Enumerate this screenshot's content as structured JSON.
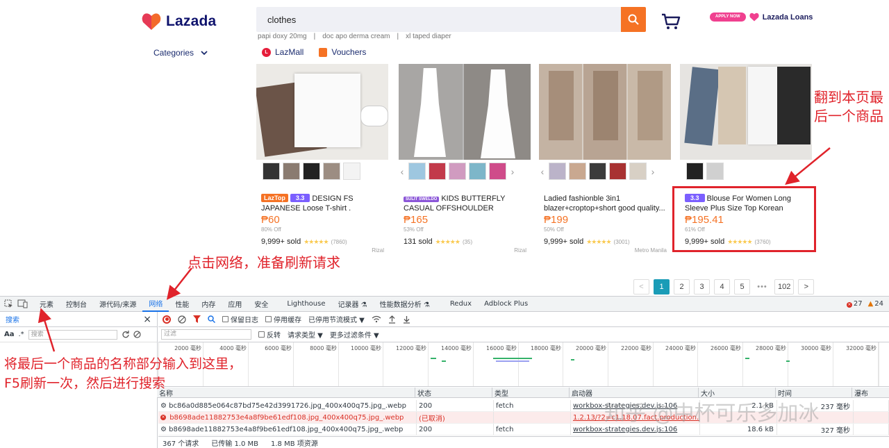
{
  "header": {
    "logo_text": "Lazada",
    "search_value": "clothes",
    "suggestions": [
      "papi doxy 20mg",
      "doc apo derma cream",
      "xl taped diaper"
    ],
    "loans_badge": "APPLY NOW",
    "loans_label": "Lazada Loans",
    "categories_label": "Categories",
    "lazmall_label": "LazMall",
    "vouchers_label": "Vouchers"
  },
  "products": [
    {
      "badge": "LazTop",
      "badge2": "3.3",
      "name": "DESIGN FS JAPANESE Loose T-shirt . Unisex....",
      "price": "₱60",
      "off": "80% Off",
      "sold": "9,999+ sold",
      "stars": "★★★★★",
      "reviews": "(7860)",
      "location": "Rizal"
    },
    {
      "badge": "SULIT SWELDO",
      "name": "KIDS BUTTERFLY CASUAL OFFSHOULDER ELEGANT DRESS F...",
      "price": "₱165",
      "off": "53% Off",
      "sold": "131 sold",
      "stars": "★★★★★",
      "reviews": "(35)",
      "location": "Rizal"
    },
    {
      "name": "Ladied fashionble 3in1 blazer+croptop+short good quality...",
      "price": "₱199",
      "off": "50% Off",
      "sold": "9,999+ sold",
      "stars": "★★★★★",
      "reviews": "(3001)",
      "location": "Metro Manila"
    },
    {
      "badge2": "3.3",
      "name": "Blouse For Women Long Sleeve Plus Size Top Korean Style...",
      "price": "₱195.41",
      "off": "61% Off",
      "sold": "9,999+ sold",
      "stars": "★★★★★",
      "reviews": "(3760)"
    }
  ],
  "pagination": {
    "prev": "<",
    "pages": [
      "1",
      "2",
      "3",
      "4",
      "5"
    ],
    "dots": "•••",
    "last": "102",
    "next": ">"
  },
  "annotations": {
    "last_product": "翻到本页最后一个商品",
    "click_network": "点击网络，准备刷新请求",
    "search_hint_1": "将最后一个商品的名称部分输入到这里，",
    "search_hint_2": "F5刷新一次，然后进行搜索"
  },
  "devtools": {
    "tabs": [
      "元素",
      "控制台",
      "源代码/来源",
      "网络",
      "性能",
      "内存",
      "应用",
      "安全",
      "Lighthouse",
      "记录器 ⚗",
      "性能数据分析 ⚗",
      "Redux",
      "Adblock Plus"
    ],
    "errors": "27",
    "warnings": "24",
    "search_panel_title": "搜索",
    "search_placeholder": "搜索",
    "aa": "Aa",
    "regex": ".*",
    "preserve_log": "保留日志",
    "disable_cache": "停用缓存",
    "throttle": "已停用节流模式",
    "filter_placeholder": "过滤",
    "invert": "反转",
    "request_type": "请求类型 ▼",
    "more_filters": "更多过滤条件 ▼",
    "timeline_ticks": [
      "2000 毫秒",
      "4000 毫秒",
      "6000 毫秒",
      "8000 毫秒",
      "10000 毫秒",
      "12000 毫秒",
      "14000 毫秒",
      "16000 毫秒",
      "18000 毫秒",
      "20000 毫秒",
      "22000 毫秒",
      "24000 毫秒",
      "26000 毫秒",
      "28000 毫秒",
      "30000 毫秒",
      "32000 毫秒"
    ],
    "columns": [
      "名称",
      "状态",
      "类型",
      "启动器",
      "大小",
      "时间",
      "瀑布"
    ],
    "rows": [
      {
        "name": "⚙ bc86a0d885e064c87bd75e42d3991726.jpg_400x400q75.jpg_.webp",
        "status": "200",
        "type": "fetch",
        "initiator": "workbox-strategies.dev.js:106",
        "size": "2.1 kB",
        "time": "237 毫秒"
      },
      {
        "name": "b8698ade11882753e4a8f9be61edf108.jpg_400x400q75.jpg_.webp",
        "status": "(已取消)",
        "type": "",
        "initiator": "1.2.13/?2=c1.18.07.fact.production...",
        "size": "",
        "time": ""
      },
      {
        "name": "⚙ b8698ade11882753e4a8f9be61edf108.jpg_400x400q75.jpg_.webp",
        "status": "200",
        "type": "fetch",
        "initiator": "workbox-strategies.dev.js:106",
        "size": "18.6 kB",
        "time": "327 毫秒"
      }
    ],
    "status_requests": "367 个请求",
    "status_transferred": "已传输 1.0 MB",
    "status_resources": "1.8 MB 项资源"
  },
  "watermark": "知乎 @中杯可乐多加冰",
  "colors": {
    "accent": "#f57224",
    "brand_navy": "#0f136d",
    "annotation_red": "#e0232b",
    "devtools_blue": "#1a73e8",
    "page_active": "#1a9cb7"
  }
}
